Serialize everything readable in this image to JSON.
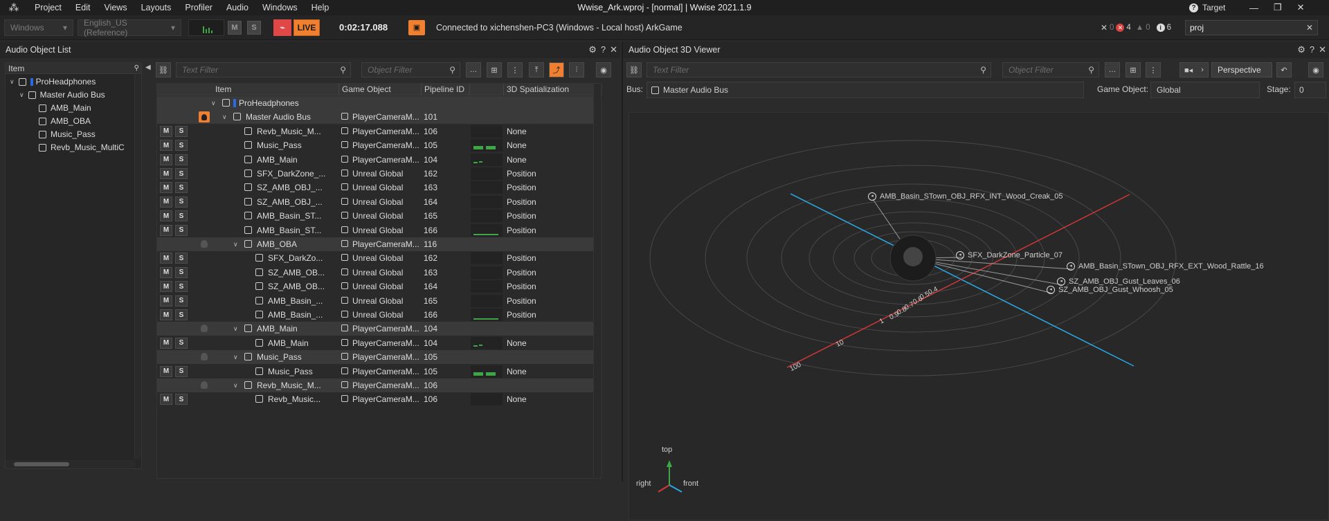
{
  "app": {
    "title": "Wwise_Ark.wproj - [normal] | Wwise 2021.1.9",
    "menus": [
      "Project",
      "Edit",
      "Views",
      "Layouts",
      "Profiler",
      "Audio",
      "Windows",
      "Help"
    ],
    "target_label": "Target"
  },
  "toolbar": {
    "platform": "Windows",
    "language": "English_US (Reference)",
    "mute": "M",
    "solo": "S",
    "live": "LIVE",
    "time": "0:02:17.088",
    "connection": "Connected to xichenshen-PC3 (Windows - Local host) ArkGame",
    "errors": "4",
    "warnings": "0",
    "infos": "6",
    "errors_prefix": "0",
    "search_value": "proj"
  },
  "left": {
    "title": "Audio Object List",
    "tree_header": "Item",
    "tree": [
      {
        "label": "ProHeadphones",
        "indent": 0
      },
      {
        "label": "Master Audio Bus",
        "indent": 1
      },
      {
        "label": "AMB_Main",
        "indent": 2
      },
      {
        "label": "AMB_OBA",
        "indent": 2
      },
      {
        "label": "Music_Pass",
        "indent": 2
      },
      {
        "label": "Revb_Music_MultiC",
        "indent": 2
      }
    ],
    "text_filter": "Text Filter",
    "object_filter": "Object Filter",
    "columns": [
      "Item",
      "Game Object",
      "Pipeline ID",
      "3D Spatialization"
    ],
    "rows": [
      {
        "ms": false,
        "kind": "header",
        "indent": 0,
        "item": "ProHeadphones",
        "go": "",
        "pid": "",
        "spat": ""
      },
      {
        "ms": false,
        "kind": "header",
        "indent": 1,
        "item": "Master Audio Bus",
        "go": "PlayerCameraM...",
        "pid": "101",
        "spat": "",
        "dot": "active"
      },
      {
        "ms": true,
        "kind": "leaf",
        "indent": 2,
        "item": "Revb_Music_M...",
        "go": "PlayerCameraM...",
        "pid": "106",
        "spat": "None",
        "meter": 0
      },
      {
        "ms": true,
        "kind": "leaf",
        "indent": 2,
        "item": "Music_Pass",
        "go": "PlayerCameraM...",
        "pid": "105",
        "spat": "None",
        "meter": 2
      },
      {
        "ms": true,
        "kind": "leaf",
        "indent": 2,
        "item": "AMB_Main",
        "go": "PlayerCameraM...",
        "pid": "104",
        "spat": "None",
        "meter": 1
      },
      {
        "ms": true,
        "kind": "leaf",
        "indent": 2,
        "item": "SFX_DarkZone_...",
        "go": "Unreal Global",
        "pid": "162",
        "spat": "Position",
        "meter": 0
      },
      {
        "ms": true,
        "kind": "leaf",
        "indent": 2,
        "item": "SZ_AMB_OBJ_...",
        "go": "Unreal Global",
        "pid": "163",
        "spat": "Position",
        "meter": 0
      },
      {
        "ms": true,
        "kind": "leaf",
        "indent": 2,
        "item": "SZ_AMB_OBJ_...",
        "go": "Unreal Global",
        "pid": "164",
        "spat": "Position",
        "meter": 0
      },
      {
        "ms": true,
        "kind": "leaf",
        "indent": 2,
        "item": "AMB_Basin_ST...",
        "go": "Unreal Global",
        "pid": "165",
        "spat": "Position",
        "meter": 0
      },
      {
        "ms": true,
        "kind": "leaf",
        "indent": 2,
        "item": "AMB_Basin_ST...",
        "go": "Unreal Global",
        "pid": "166",
        "spat": "Position",
        "meter": 3
      },
      {
        "ms": false,
        "kind": "header",
        "indent": 2,
        "item": "AMB_OBA",
        "go": "PlayerCameraM...",
        "pid": "116",
        "spat": "",
        "dot": "dim"
      },
      {
        "ms": true,
        "kind": "leaf",
        "indent": 3,
        "item": "SFX_DarkZo...",
        "go": "Unreal Global",
        "pid": "162",
        "spat": "Position",
        "meter": 0
      },
      {
        "ms": true,
        "kind": "leaf",
        "indent": 3,
        "item": "SZ_AMB_OB...",
        "go": "Unreal Global",
        "pid": "163",
        "spat": "Position",
        "meter": 0
      },
      {
        "ms": true,
        "kind": "leaf",
        "indent": 3,
        "item": "SZ_AMB_OB...",
        "go": "Unreal Global",
        "pid": "164",
        "spat": "Position",
        "meter": 0
      },
      {
        "ms": true,
        "kind": "leaf",
        "indent": 3,
        "item": "AMB_Basin_...",
        "go": "Unreal Global",
        "pid": "165",
        "spat": "Position",
        "meter": 0
      },
      {
        "ms": true,
        "kind": "leaf",
        "indent": 3,
        "item": "AMB_Basin_...",
        "go": "Unreal Global",
        "pid": "166",
        "spat": "Position",
        "meter": 3
      },
      {
        "ms": false,
        "kind": "header",
        "indent": 2,
        "item": "AMB_Main",
        "go": "PlayerCameraM...",
        "pid": "104",
        "spat": "",
        "dot": "dim"
      },
      {
        "ms": true,
        "kind": "leaf",
        "indent": 3,
        "item": "AMB_Main",
        "go": "PlayerCameraM...",
        "pid": "104",
        "spat": "None",
        "meter": 1
      },
      {
        "ms": false,
        "kind": "header",
        "indent": 2,
        "item": "Music_Pass",
        "go": "PlayerCameraM...",
        "pid": "105",
        "spat": "",
        "dot": "dim"
      },
      {
        "ms": true,
        "kind": "leaf",
        "indent": 3,
        "item": "Music_Pass",
        "go": "PlayerCameraM...",
        "pid": "105",
        "spat": "None",
        "meter": 2
      },
      {
        "ms": false,
        "kind": "header",
        "indent": 2,
        "item": "Revb_Music_M...",
        "go": "PlayerCameraM...",
        "pid": "106",
        "spat": "",
        "dot": "dim"
      },
      {
        "ms": true,
        "kind": "leaf",
        "indent": 3,
        "item": "Revb_Music...",
        "go": "PlayerCameraM...",
        "pid": "106",
        "spat": "None",
        "meter": 0
      }
    ]
  },
  "right": {
    "title": "Audio Object 3D Viewer",
    "text_filter": "Text Filter",
    "object_filter": "Object Filter",
    "view": "Perspective",
    "bus_label": "Bus:",
    "bus_value": "Master Audio Bus",
    "go_label": "Game Object:",
    "go_value": "Global",
    "stage_label": "Stage:",
    "stage_value": "0",
    "objects": [
      "AMB_Basin_STown_OBJ_RFX_INT_Wood_Creak_05",
      "SFX_DarkZone_Particle_07",
      "AMB_Basin_STown_OBJ_RFX_EXT_Wood_Rattle_16",
      "SZ_AMB_OBJ_Gust_Leaves_06",
      "SZ_AMB_OBJ_Gust_Whoosh_05"
    ],
    "scale": [
      "100",
      "10",
      "1",
      "0.9",
      "0.8",
      "0.7",
      "0.6",
      "0.5",
      "0.4"
    ],
    "axes": {
      "top": "top",
      "right": "right",
      "front": "front"
    }
  },
  "colors": {
    "live": "#f08030",
    "green": "#3fa646",
    "x_axis": "#d23838",
    "y_axis": "#2aa8e0"
  }
}
